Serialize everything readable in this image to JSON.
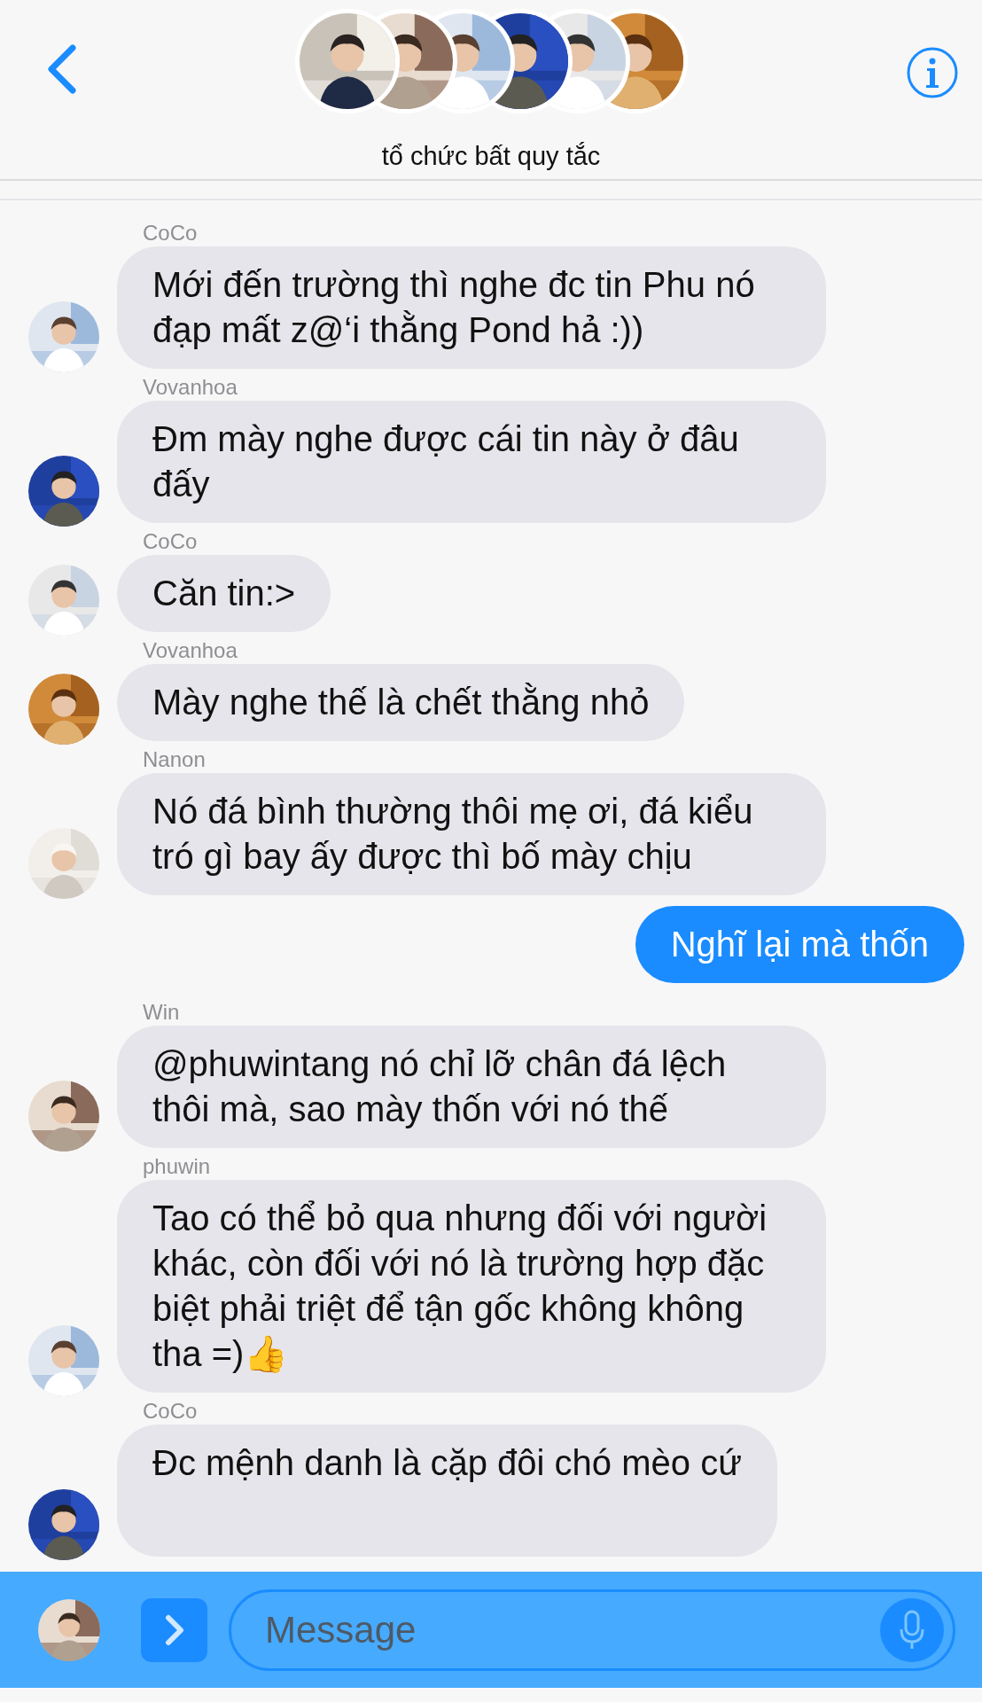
{
  "header": {
    "title": "tổ chức bất quy tắc"
  },
  "messages": [
    {
      "kind": "incoming",
      "sender": "CoCo",
      "text": "Mới đến trường thì nghe đc tin Phu nó đạp mất z@‘i thằng Pond hả :))"
    },
    {
      "kind": "incoming",
      "sender": "Vovanhoa",
      "text": "Đm mày nghe được cái tin này ở đâu đấy"
    },
    {
      "kind": "incoming",
      "sender": "CoCo",
      "text": "Căn tin:>"
    },
    {
      "kind": "incoming",
      "sender": "Vovanhoa",
      "text": "Mày nghe thế là chết thằng nhỏ"
    },
    {
      "kind": "incoming",
      "sender": "Nanon",
      "text": "Nó đá bình thường thôi mẹ ơi, đá kiểu tró gì bay ấy được thì bố mày chịu"
    },
    {
      "kind": "outgoing",
      "text": "Nghĩ lại mà thốn"
    },
    {
      "kind": "incoming",
      "sender": "Win",
      "text": "@phuwintang nó chỉ lỡ chân đá lệch thôi mà, sao mày thốn với nó thế"
    },
    {
      "kind": "incoming",
      "sender": "phuwin",
      "text": "Tao có thể bỏ qua nhưng đối với người khác, còn đối với nó là trường hợp đặc biệt phải triệt để tận gốc không không tha =)👍"
    },
    {
      "kind": "incoming",
      "sender": "CoCo",
      "text": "Đc mệnh danh là cặp đôi chó mèo cứ"
    }
  ],
  "composer": {
    "placeholder": "Message"
  }
}
